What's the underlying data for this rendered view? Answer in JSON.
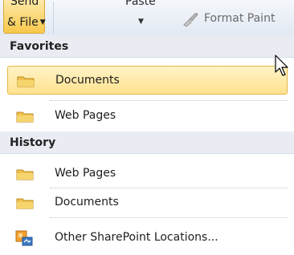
{
  "ribbon": {
    "send_line1": "Send",
    "send_line2": "& File",
    "paste_label": "Paste",
    "format_painter_label": "Format Paint"
  },
  "menu": {
    "favorites_header": "Favorites",
    "favorites": [
      {
        "label": "Documents",
        "icon": "folder-icon",
        "selected": true
      },
      {
        "label": "Web Pages",
        "icon": "folder-icon",
        "selected": false
      }
    ],
    "history_header": "History",
    "history": [
      {
        "label": "Web Pages",
        "icon": "folder-icon"
      },
      {
        "label": "Documents",
        "icon": "folder-icon"
      }
    ],
    "other": {
      "label": "Other SharePoint Locations...",
      "icon": "sharepoint-location-icon"
    }
  },
  "colors": {
    "selected_fill": "#ffe28e",
    "selected_border": "#e6b84c",
    "header_bg": "#e9edf3"
  }
}
